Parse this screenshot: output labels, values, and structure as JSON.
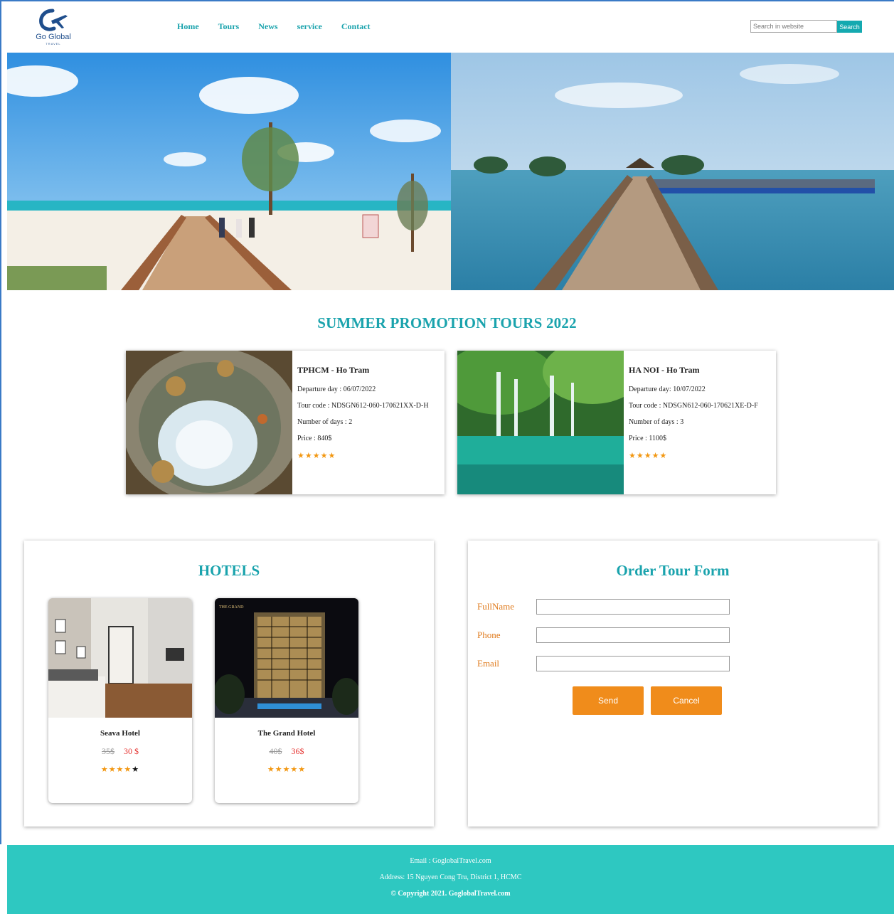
{
  "brand": {
    "name": "Go Global",
    "tagline": "TRAVEL",
    "logo_icon": "plane-logo-icon",
    "accent_color": "#1aa3ad",
    "orange_color": "#f08c1b"
  },
  "nav": {
    "items": [
      {
        "label": "Home"
      },
      {
        "label": "Tours"
      },
      {
        "label": "News"
      },
      {
        "label": "service"
      },
      {
        "label": "Contact"
      }
    ]
  },
  "search": {
    "placeholder": "Search in website",
    "button_label": "Search"
  },
  "promo": {
    "title": "SUMMER PROMOTION TOURS 2022",
    "tours": [
      {
        "name": "TPHCM - Ho Tram",
        "departure": "Departure day : 06/07/2022",
        "code": "Tour code : NDSGN612-060-170621XX-D-H",
        "days": "Number of days : 2",
        "price": "Price : 840$",
        "stars": "★★★★★"
      },
      {
        "name": "HA NOI - Ho Tram",
        "departure": "Departure day: 10/07/2022",
        "code": "Tour code : NDSGN612-060-170621XE-D-F",
        "days": "Number of days : 3",
        "price": "Price : 1100$",
        "stars": "★★★★★"
      }
    ]
  },
  "hotels": {
    "title": "HOTELS",
    "items": [
      {
        "name": "Seava Hotel",
        "old_price": "35$",
        "new_price": "30 $",
        "stars_filled": "★★★★",
        "stars_empty": "★",
        "rating": 4
      },
      {
        "name": "The Grand Hotel",
        "old_price": "40$",
        "new_price": "36$",
        "stars_filled": "★★★★★",
        "stars_empty": "",
        "rating": 5,
        "sign": "THE GRAND"
      }
    ]
  },
  "order_form": {
    "title": "Order Tour Form",
    "fields": [
      {
        "label": "FullName",
        "value": ""
      },
      {
        "label": "Phone",
        "value": ""
      },
      {
        "label": "Email",
        "value": ""
      }
    ],
    "send_label": "Send",
    "cancel_label": "Cancel"
  },
  "footer": {
    "email": "Email : GoglobalTravel.com",
    "address": "Address: 15 Nguyen Cong Tru, District 1, HCMC",
    "copyright": "© Copyright 2021. GoglobalTravel.com"
  }
}
